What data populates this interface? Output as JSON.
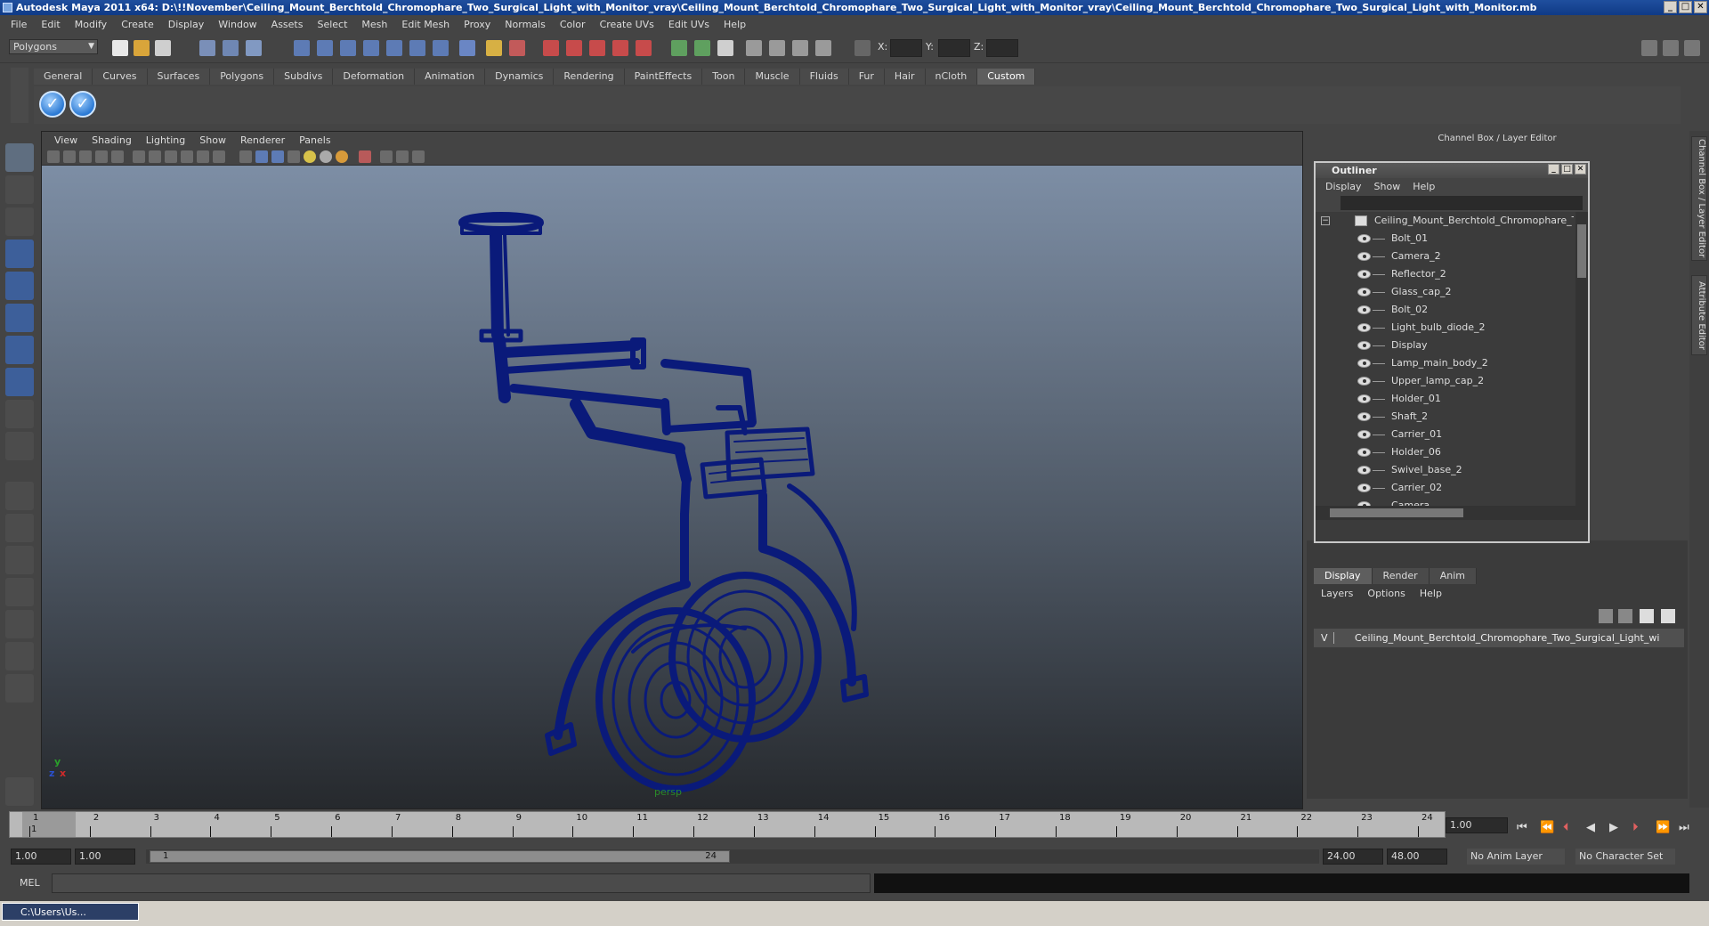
{
  "window": {
    "title": "Autodesk Maya 2011 x64: D:\\!!November\\Ceiling_Mount_Berchtold_Chromophare_Two_Surgical_Light_with_Monitor_vray\\Ceiling_Mount_Berchtold_Chromophare_Two_Surgical_Light_with_Monitor_vray\\Ceiling_Mount_Berchtold_Chromophare_Two_Surgical_Light_with_Monitor.mb",
    "min": "_",
    "max": "□",
    "close": "✕"
  },
  "menubar": [
    "File",
    "Edit",
    "Modify",
    "Create",
    "Display",
    "Window",
    "Assets",
    "Select",
    "Mesh",
    "Edit Mesh",
    "Proxy",
    "Normals",
    "Color",
    "Create UVs",
    "Edit UVs",
    "Help"
  ],
  "statusline": {
    "mode": "Polygons",
    "x_label": "X:",
    "y_label": "Y:",
    "z_label": "Z:"
  },
  "shelf_tabs": [
    "General",
    "Curves",
    "Surfaces",
    "Polygons",
    "Subdivs",
    "Deformation",
    "Animation",
    "Dynamics",
    "Rendering",
    "PaintEffects",
    "Toon",
    "Muscle",
    "Fluids",
    "Fur",
    "Hair",
    "nCloth",
    "Custom"
  ],
  "shelf_active": "Custom",
  "viewport": {
    "menu": [
      "View",
      "Shading",
      "Lighting",
      "Show",
      "Renderer",
      "Panels"
    ],
    "camera_label": "persp",
    "axis_y": "y",
    "axis_x": "x",
    "axis_z": "z"
  },
  "channel_box_title": "Channel Box / Layer Editor",
  "side_tabs": [
    "Channel Box / Layer Editor",
    "Attribute Editor"
  ],
  "outliner": {
    "title": "Outliner",
    "menu": [
      "Display",
      "Show",
      "Help"
    ],
    "root": "Ceiling_Mount_Berchtold_Chromophare_Two",
    "items": [
      "Bolt_01",
      "Camera_2",
      "Reflector_2",
      "Glass_cap_2",
      "Bolt_02",
      "Light_bulb_diode_2",
      "Display",
      "Lamp_main_body_2",
      "Upper_lamp_cap_2",
      "Holder_01",
      "Shaft_2",
      "Carrier_01",
      "Holder_06",
      "Swivel_base_2",
      "Carrier_02",
      "Camera"
    ]
  },
  "layer_editor": {
    "tabs": [
      "Display",
      "Render",
      "Anim"
    ],
    "active_tab": "Display",
    "menu": [
      "Layers",
      "Options",
      "Help"
    ],
    "layer_visible": "V",
    "layer_name": "Ceiling_Mount_Berchtold_Chromophare_Two_Surgical_Light_wi"
  },
  "timeline": {
    "ticks": [
      "1",
      "2",
      "3",
      "4",
      "5",
      "6",
      "7",
      "8",
      "9",
      "10",
      "11",
      "12",
      "13",
      "14",
      "15",
      "16",
      "17",
      "18",
      "19",
      "20",
      "21",
      "22",
      "23",
      "24"
    ],
    "current_marker": "1",
    "current_time": "1.00"
  },
  "range": {
    "start_time": "1.00",
    "playback_start": "1.00",
    "handle_start": "1",
    "handle_end": "24",
    "playback_end": "24.00",
    "end_time": "48.00",
    "anim_layer": "No Anim Layer",
    "character_set": "No Character Set"
  },
  "cmdline": {
    "label": "MEL"
  },
  "taskbar": {
    "item": "C:\\Users\\Us..."
  },
  "colors": {
    "wireframe": "#0a1a7a",
    "accent": "#1f4f9e"
  }
}
